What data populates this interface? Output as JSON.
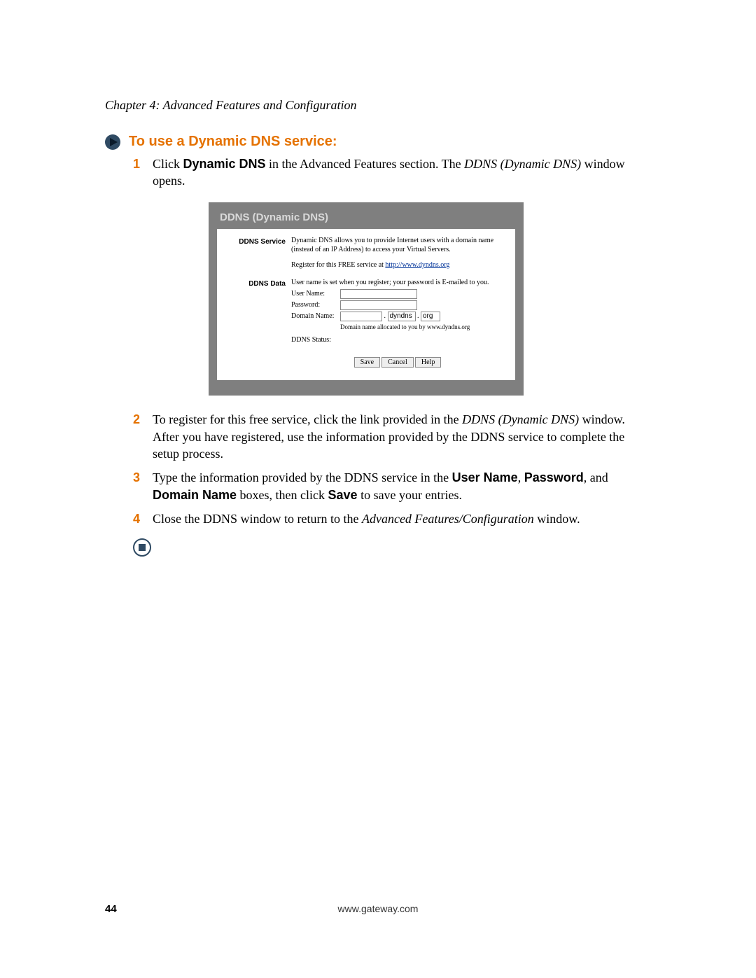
{
  "chapter": "Chapter 4: Advanced Features and Configuration",
  "heading": "To use a Dynamic DNS service:",
  "steps": {
    "s1": {
      "a": "Click ",
      "b": "Dynamic DNS",
      "c": " in the Advanced Features section. The ",
      "d": "DDNS (Dynamic DNS)",
      "e": " window opens."
    },
    "s2": {
      "a": "To register for this free service, click the link provided in the ",
      "b": "DDNS (Dynamic DNS)",
      "c": " window. After you have registered, use the information provided by the DDNS service to complete the setup process."
    },
    "s3": {
      "a": "Type the information provided by the DDNS service in the ",
      "b": "User Name",
      "c": ", ",
      "d": "Password",
      "e": ", and ",
      "f": "Domain Name",
      "g": " boxes, then click ",
      "h": "Save",
      "i": " to save your entries."
    },
    "s4": {
      "a": "Close the DDNS window to return to the ",
      "b": "Advanced Features/Configuration",
      "c": " window."
    }
  },
  "shot": {
    "title": "DDNS (Dynamic DNS)",
    "service_label": "DDNS Service",
    "service_desc": "Dynamic DNS allows you to provide Internet users with a domain name (instead of an IP Address) to access your Virtual Servers.",
    "register_pre": "Register for this FREE service at ",
    "register_link": "http://www.dyndns.org",
    "data_label": "DDNS Data",
    "data_desc": "User name is set when you register; your password is E-mailed to you.",
    "user_name_label": "User Name:",
    "password_label": "Password:",
    "domain_name_label": "Domain Name:",
    "domain_val1": "dyndns",
    "domain_val2": "org",
    "allocated": "Domain name allocated to you by www.dyndns.org",
    "status_label": "DDNS Status:",
    "save": "Save",
    "cancel": "Cancel",
    "help": "Help"
  },
  "footer": {
    "page": "44",
    "url": "www.gateway.com"
  }
}
